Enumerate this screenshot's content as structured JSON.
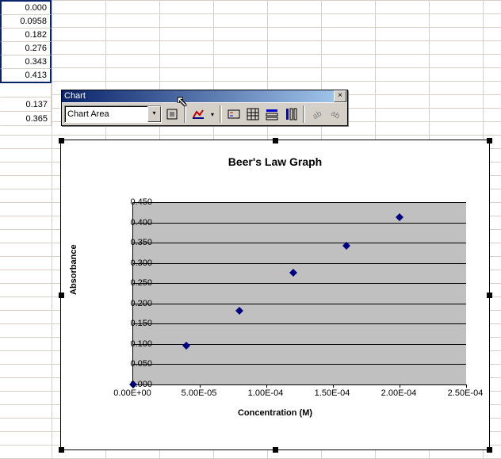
{
  "spreadsheet": {
    "columnA": [
      "0.000",
      "0.0958",
      "0.182",
      "0.276",
      "0.343",
      "0.413",
      "",
      "0.137",
      "0.365"
    ],
    "selected_range": [
      0,
      5
    ]
  },
  "toolbar": {
    "title": "Chart",
    "selector_value": "Chart Area",
    "close_glyph": "×",
    "dropdown_glyph": "▾"
  },
  "chart_data": {
    "type": "scatter",
    "title": "Beer's Law Graph",
    "xlabel": "Concentration (M)",
    "ylabel": "Absorbance",
    "xlim": [
      0.0,
      0.00025
    ],
    "ylim": [
      0.0,
      0.45
    ],
    "x": [
      0.0,
      4e-05,
      8e-05,
      0.00012,
      0.00016,
      0.0002
    ],
    "y": [
      0.0,
      0.0958,
      0.182,
      0.276,
      0.343,
      0.413
    ],
    "xticks": [
      "0.00E+00",
      "5.00E-05",
      "1.00E-04",
      "1.50E-04",
      "2.00E-04",
      "2.50E-04"
    ],
    "yticks": [
      "0.000",
      "0.050",
      "0.100",
      "0.150",
      "0.200",
      "0.250",
      "0.300",
      "0.350",
      "0.400",
      "0.450"
    ]
  }
}
